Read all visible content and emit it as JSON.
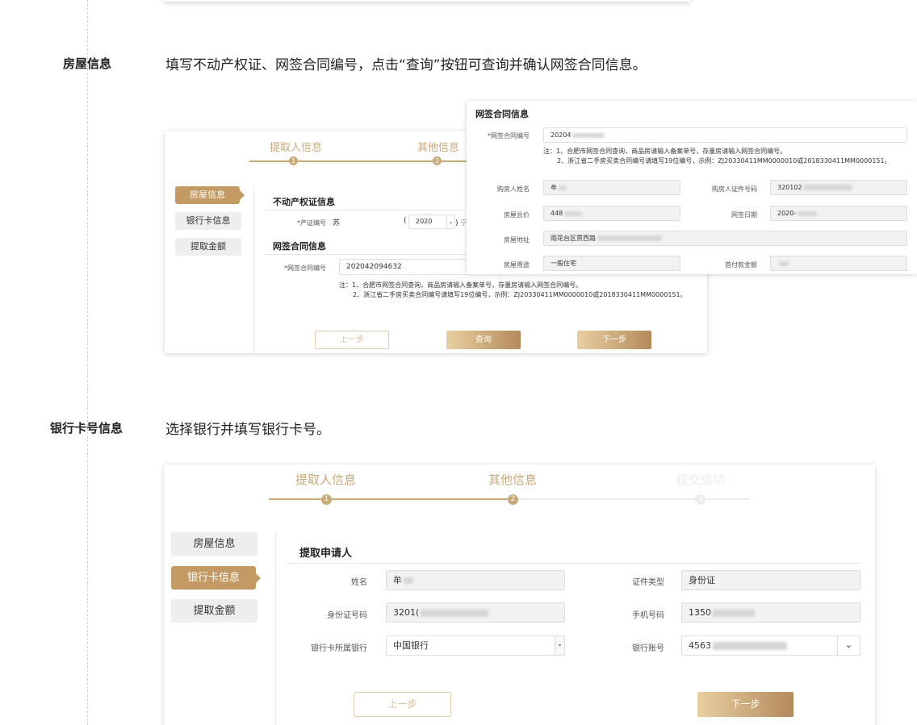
{
  "sections": {
    "house": {
      "title": "房屋信息",
      "desc": "填写不动产权证、网签合同编号，点击“查询”按钮可查询并确认网签合同信息。"
    },
    "bank": {
      "title": "银行卡号信息",
      "desc": "选择银行并填写银行卡号。"
    }
  },
  "steps": {
    "step1": "提取人信息",
    "step2": "其他信息",
    "step3": "提交成功",
    "dot1": "1",
    "dot2": "2",
    "dot3": "3"
  },
  "tabs": {
    "house": "房屋信息",
    "bank": "银行卡信息",
    "amount": "提取金额"
  },
  "screen1": {
    "property_title": "不动产权证信息",
    "cert_label": "*产证编号",
    "cert_prefix": "苏",
    "paren_open": "(",
    "year_value": "2020",
    "paren_close": ")",
    "cert_suffix": "宁",
    "contract_title": "网签合同信息",
    "contract_label": "*网签合同编号",
    "contract_value": "202042094632",
    "note1": "注：1、合肥市网签合同查询，商品房请输入备案单号，存量房请输入网签合同编号。",
    "note2": "2、浙江省二手房买卖合同编号请填写19位编号，示例：ZJ20330411MM0000010或2018330411MM0000151。",
    "prev": "上一步",
    "query": "查询",
    "next": "下一步"
  },
  "popup": {
    "title": "网签合同信息",
    "contract_label": "*网签合同编号",
    "contract_value": "20204",
    "note1": "注：1、合肥市网签合同查询，商品房请输入备案单号，存量房请输入网签合同编号。",
    "note2": "2、浙江省二手房买卖合同编号请填写19位编号，示例：ZJ20330411MM0000010或2018330411MM0000151。",
    "buyer_name_label": "购房人姓名",
    "buyer_name_value": "牟",
    "buyer_id_label": "购房人证件号码",
    "buyer_id_value": "320102",
    "total_label": "房屋总价",
    "total_value": "448",
    "sign_date_label": "网签日期",
    "sign_date_value": "2020-",
    "address_label": "房屋地址",
    "address_value": "雨花台区贾西路",
    "usage_label": "房屋用途",
    "usage_value": "一般住宅",
    "down_label": "首付款金额",
    "down_value": ""
  },
  "screen2": {
    "applicant_title": "提取申请人",
    "name_label": "姓名",
    "name_value": "牟",
    "id_type_label": "证件类型",
    "id_type_value": "身份证",
    "id_no_label": "身份证号码",
    "id_no_value": "3201(",
    "phone_label": "手机号码",
    "phone_value": "1350",
    "bank_label": "银行卡所属银行",
    "bank_value": "中国银行",
    "account_label": "银行账号",
    "account_value": "4563",
    "prev": "上一步",
    "next": "下一步"
  }
}
